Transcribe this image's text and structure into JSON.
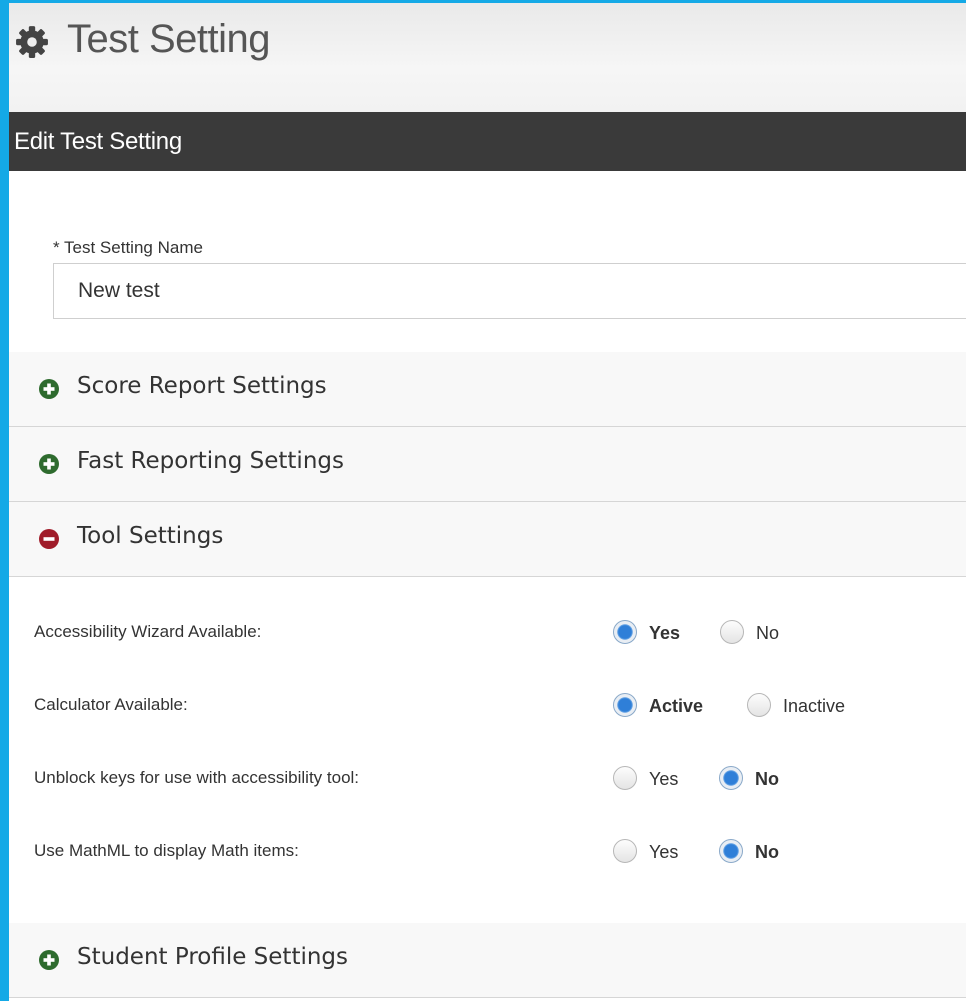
{
  "page": {
    "title": "Test Setting",
    "icon": "gear-icon"
  },
  "edit_bar": {
    "label": "Edit Test Setting"
  },
  "form": {
    "name_label": "* Test Setting Name",
    "name_value": "New test"
  },
  "sections": {
    "score_report": {
      "label": "Score Report Settings",
      "state": "collapsed",
      "icon": "plus-circle-icon"
    },
    "fast_reporting": {
      "label": "Fast Reporting Settings",
      "state": "collapsed",
      "icon": "plus-circle-icon"
    },
    "tool": {
      "label": "Tool Settings",
      "state": "expanded",
      "icon": "minus-circle-icon"
    },
    "student_profile": {
      "label": "Student Profile Settings",
      "state": "collapsed",
      "icon": "plus-circle-icon"
    }
  },
  "tool_settings": [
    {
      "label": "Accessibility Wizard Available:",
      "options": [
        "Yes",
        "No"
      ],
      "selected": "Yes"
    },
    {
      "label": "Calculator Available:",
      "options": [
        "Active",
        "Inactive"
      ],
      "selected": "Active"
    },
    {
      "label": "Unblock keys for use with accessibility tool:",
      "options": [
        "Yes",
        "No"
      ],
      "selected": "No"
    },
    {
      "label": "Use MathML to display Math items:",
      "options": [
        "Yes",
        "No"
      ],
      "selected": "No"
    }
  ],
  "colors": {
    "frame_accent": "#14a9e6",
    "header_bar": "#3a3a3a",
    "expand_icon": "#2e6b2e",
    "collapse_icon": "#a01c2a",
    "radio_checked": "#2f7fd8"
  }
}
